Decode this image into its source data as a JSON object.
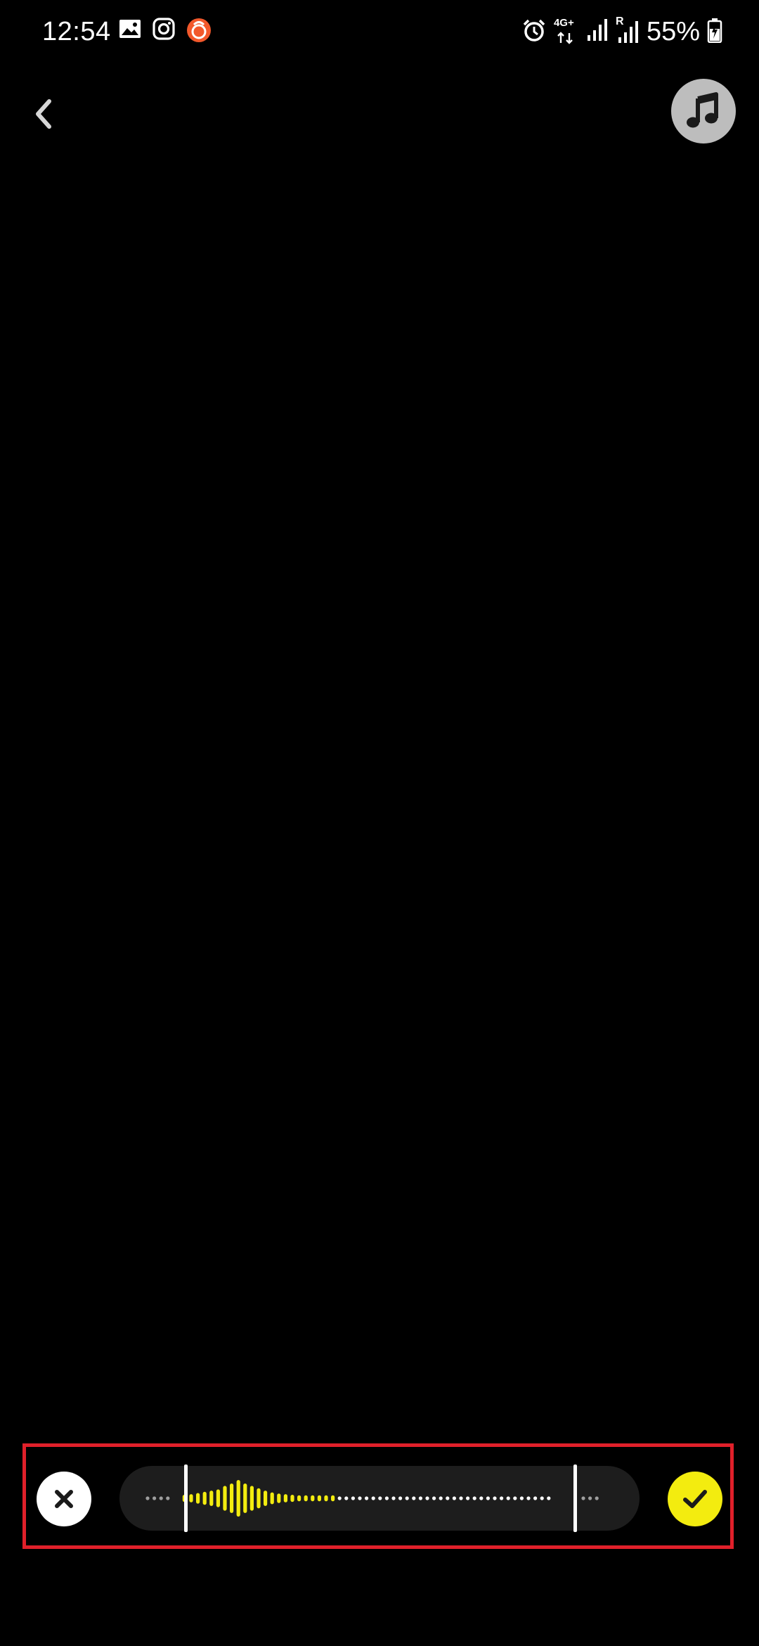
{
  "status_bar": {
    "time": "12:54",
    "battery_percent": "55%",
    "network_label": "4G+",
    "roaming_label": "R",
    "left_icons": [
      "gallery-icon",
      "instagram-icon",
      "app-notification-icon"
    ],
    "right_icons": [
      "alarm-icon",
      "network-4g-icon",
      "signal-icon",
      "signal-roaming-icon",
      "battery-charging-icon"
    ]
  },
  "toolbar": {
    "back_icon": "chevron-left-icon",
    "music_icon": "music-note-icon"
  },
  "trim_bar": {
    "cancel_icon": "close-icon",
    "confirm_icon": "checkmark-icon",
    "colors": {
      "highlight": "#f3ec0f",
      "unselected_dot": "#ffffff",
      "outside_dot": "#9e9e9e",
      "track": "#1d1d1d",
      "frame": "#e0202a"
    },
    "waveform": {
      "leading_dots": 4,
      "active_bar_heights": [
        0.12,
        0.14,
        0.18,
        0.22,
        0.26,
        0.3,
        0.42,
        0.5,
        0.62,
        0.5,
        0.42,
        0.34,
        0.26,
        0.2,
        0.16,
        0.14,
        0.12,
        0.1,
        0.1,
        0.1,
        0.1,
        0.1,
        0.1
      ],
      "inactive_dots": 50,
      "trailing_dots": 3,
      "selection_start_fraction": 0.06,
      "selection_end_fraction": 0.875
    }
  }
}
